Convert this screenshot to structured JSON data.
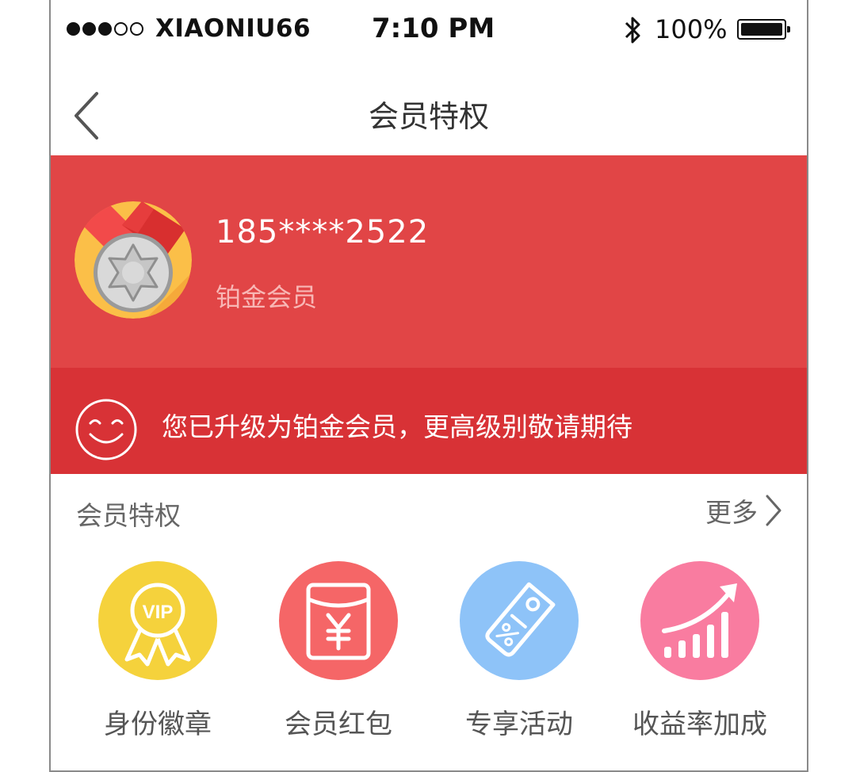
{
  "status_bar": {
    "signal_dots": [
      true,
      true,
      true,
      false,
      false
    ],
    "carrier": "XIAONIU66",
    "time": "7:10 PM",
    "battery": "100%"
  },
  "nav": {
    "title": "会员特权",
    "back_icon": "chevron-left-icon"
  },
  "member": {
    "phone": "185****2522",
    "level": "铂金会员",
    "badge_icon": "platinum-medal-icon"
  },
  "notice": {
    "icon": "smile-face-icon",
    "text": "您已升级为铂金会员，更高级别敬请期待"
  },
  "privileges": {
    "title": "会员特权",
    "more_label": "更多",
    "items": [
      {
        "label": "身份徽章",
        "icon": "vip-badge-icon",
        "color": "#f5d23c"
      },
      {
        "label": "会员红包",
        "icon": "red-envelope-icon",
        "color": "#f56667"
      },
      {
        "label": "专享活动",
        "icon": "discount-tag-icon",
        "color": "#8ec3f8"
      },
      {
        "label": "收益率加成",
        "icon": "rising-chart-icon",
        "color": "#f97ca0"
      }
    ]
  },
  "colors": {
    "hero": "#e14546",
    "notice": "#d83236"
  }
}
